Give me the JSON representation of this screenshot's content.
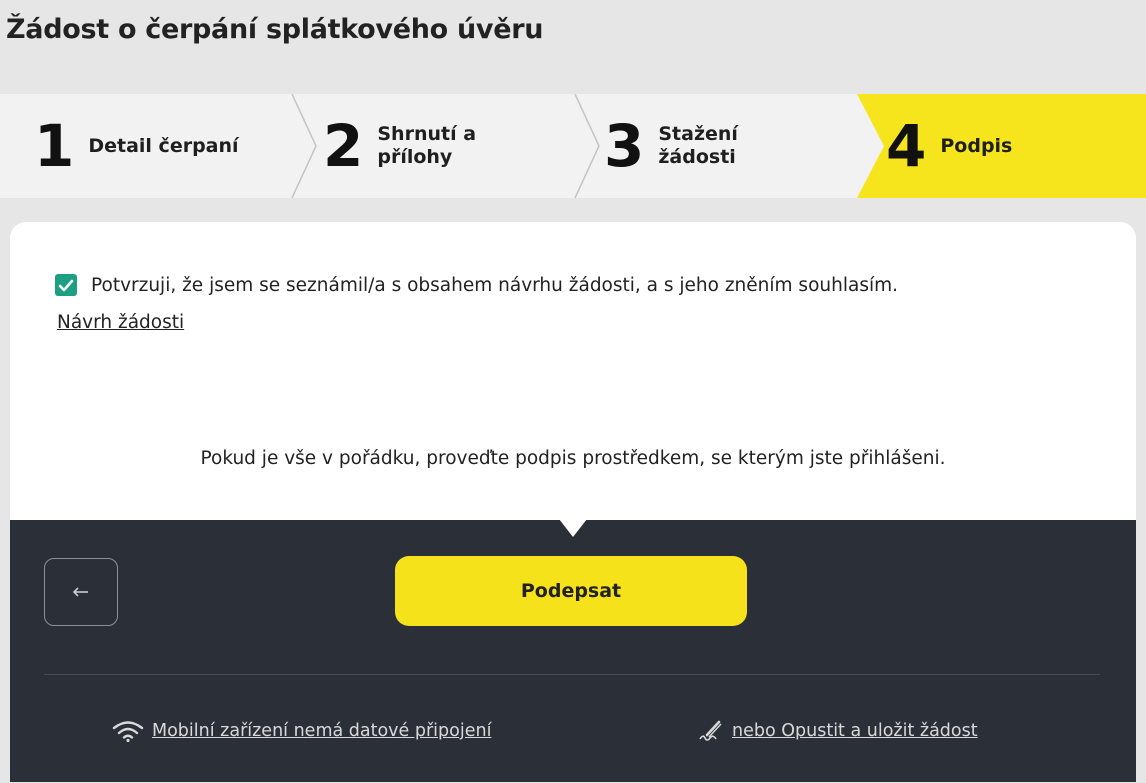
{
  "page": {
    "title": "Žádost o čerpání splátkového úvěru"
  },
  "stepper": {
    "active_color": "#f6e51c",
    "steps": [
      {
        "number": "1",
        "label": "Detail čerpaní"
      },
      {
        "number": "2",
        "label": "Shrnutí a\npřílohy"
      },
      {
        "number": "3",
        "label": "Stažení\nžádosti"
      },
      {
        "number": "4",
        "label": "Podpis",
        "active": true
      }
    ]
  },
  "consent": {
    "checked": true,
    "text": "Potvrzuji, že jsem se seznámil/a s obsahem návrhu žádosti, a s jeho zněním souhlasím.",
    "link_label": "Návrh žádosti"
  },
  "info": {
    "text": "Pokud je vše v pořádku, proveďte podpis prostředkem, se kterým jste přihlášeni."
  },
  "actions": {
    "back_icon": "arrow-left-icon",
    "sign_label": "Podepsat",
    "offline_link": "Mobilní zařízení nemá datové připojení",
    "offline_icon": "wifi-icon",
    "leave_link": "nebo Opustit a uložit žádost",
    "leave_icon": "pen-sign-icon"
  }
}
